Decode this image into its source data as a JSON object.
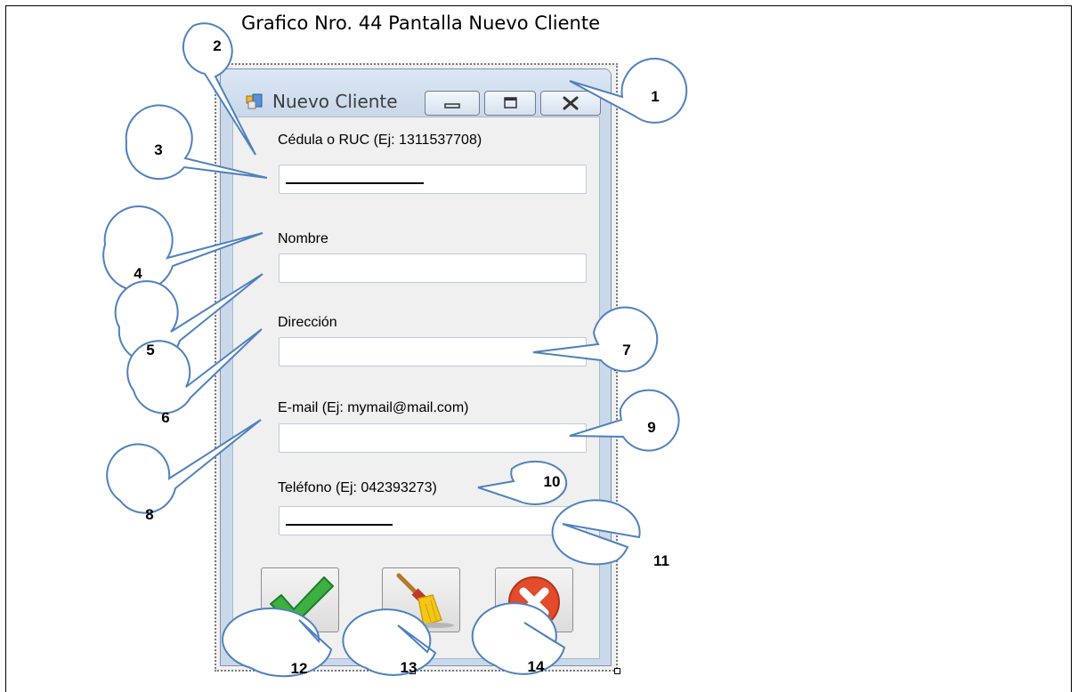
{
  "caption": "Grafico Nro. 44  Pantalla Nuevo Cliente",
  "window": {
    "title": "Nuevo Cliente"
  },
  "form": {
    "cedula_label": "Cédula o RUC (Ej: 1311537708)",
    "cedula_value": "",
    "nombre_label": "Nombre",
    "nombre_value": "",
    "direccion_label": "Dirección",
    "direccion_value": "",
    "email_label": "E-mail (Ej: mymail@mail.com)",
    "email_value": "",
    "telefono_label": "Teléfono (Ej: 042393273)",
    "telefono_value": ""
  },
  "buttons": {
    "accept_icon": "checkmark-icon",
    "clear_icon": "broom-icon",
    "cancel_icon": "cancel-x-icon"
  },
  "colors": {
    "callout_border": "#4f81bd",
    "accept_green": "#3cb043",
    "cancel_red": "#e24b2b"
  },
  "callouts": [
    "1",
    "2",
    "3",
    "4",
    "5",
    "6",
    "7",
    "8",
    "9",
    "10",
    "11",
    "12",
    "13",
    "14"
  ]
}
